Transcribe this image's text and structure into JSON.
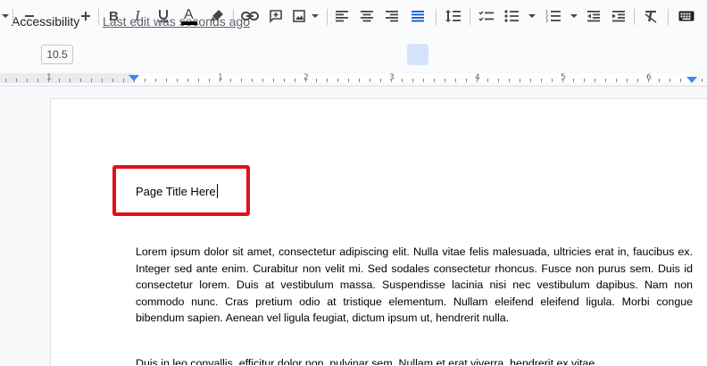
{
  "menubar": {
    "accessibility_label": "Accessibility",
    "last_edit_text": "Last edit was seconds ago"
  },
  "toolbar": {
    "font_size": "10.5",
    "icons": [
      "dropdown-arrow-icon",
      "minus-icon",
      "plus-icon",
      "bold-icon",
      "italic-icon",
      "underline-icon",
      "text-color-icon",
      "highlight-icon",
      "link-icon",
      "add-comment-icon",
      "insert-image-icon",
      "align-left-icon",
      "align-center-icon",
      "align-right-icon",
      "justify-icon",
      "line-spacing-icon",
      "checklist-icon",
      "bulleted-list-icon",
      "numbered-list-icon",
      "decrease-indent-icon",
      "increase-indent-icon",
      "clear-formatting-icon",
      "keyboard-icon"
    ]
  },
  "ruler": {
    "numbers": [
      "1",
      "1",
      "2",
      "3",
      "4",
      "5",
      "6"
    ]
  },
  "document": {
    "title": "Page Title Here",
    "paragraph1": "Lorem ipsum dolor sit amet, consectetur adipiscing elit. Nulla vitae felis malesuada, ultricies erat in, faucibus ex. Integer sed ante enim. Curabitur non velit mi. Sed sodales consectetur rhoncus. Fusce non purus sem. Duis id consectetur lorem. Duis at vestibulum massa. Suspendisse lacinia nisi nec vestibulum dapibus. Nam non commodo nunc. Cras pretium odio at tristique elementum. Nullam eleifend eleifend ligula. Morbi congue bibendum sapien. Aenean vel ligula feugiat, dictum ipsum ut, hendrerit nulla.",
    "paragraph2": "Duis in leo convallis, efficitur dolor non, pulvinar sem. Nullam et erat viverra, hendrerit ex vitae,"
  },
  "colors": {
    "highlight_border": "#e0111b",
    "active_button_bg": "#d3e3fd",
    "indent_marker": "#4285f4"
  }
}
